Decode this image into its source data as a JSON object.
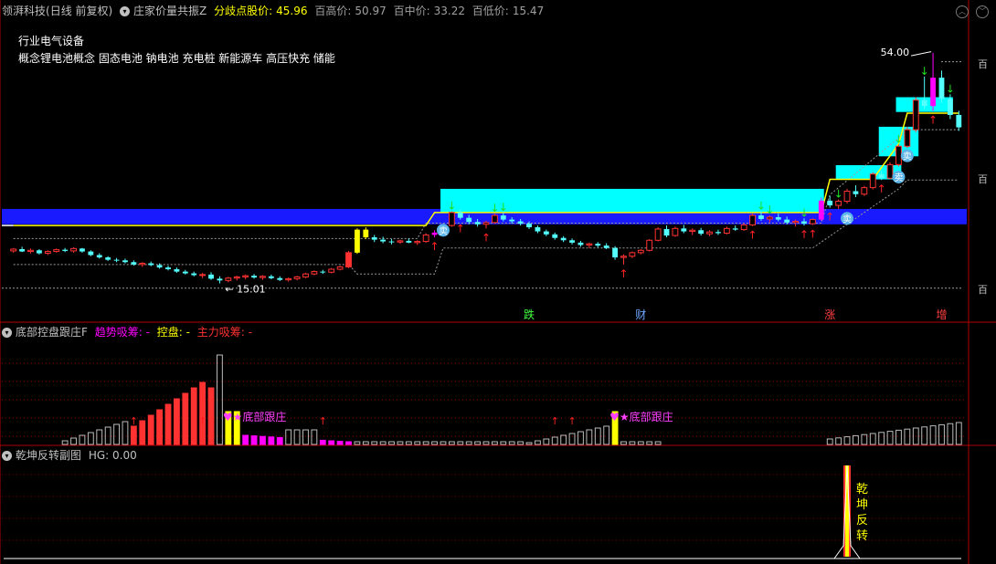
{
  "colors": {
    "up": "#ff3232",
    "down": "#54ffff",
    "yellow": "#ffff00",
    "magenta": "#ff00ff",
    "cyan_box": "#00ffff",
    "blue_band": "#1a1aff",
    "grid": "#8b0000",
    "text": "#c0c0c0"
  },
  "main_panel": {
    "stock_name": "领湃科技",
    "period": "(日线 前复权)",
    "indicator_icon": "circle-chevron-icon",
    "indicator_name": "庄家价量共振Z",
    "pivot_label": "分歧点股价:",
    "pivot_value": "45.96",
    "high_label": "百高价:",
    "high_value": "50.97",
    "mid_label": "百中价:",
    "mid_value": "33.22",
    "low_label": "百低价:",
    "low_value": "15.47",
    "industry_text": "行业电气设备",
    "concept_text": "概念锂电池概念 固态电池 钠电池 充电桩 新能源车 高压快充 储能",
    "max_label": "54.00",
    "min_label": "15.01",
    "right_labels": [
      "百",
      "百",
      "百"
    ],
    "event_markers": [
      "跌",
      "财",
      "涨",
      "增"
    ],
    "sell_marker": "卖",
    "up_arrow": "↑",
    "down_arrow": "↓"
  },
  "sub_panel_1": {
    "indicator_icon": "circle-chevron-icon",
    "name": "底部控盘跟庄F",
    "trend_label": "趋势吸筹: -",
    "control_label": "控盘: -",
    "main_label": "主力吸筹: -",
    "annotation": "底部跟庄"
  },
  "sub_panel_2": {
    "indicator_icon": "circle-chevron-icon",
    "name": "乾坤反转副图",
    "hg_label": "HG: 0.00",
    "annotation_chars": [
      "乾",
      "坤",
      "反",
      "转"
    ]
  },
  "chart_data": {
    "type": "candlestick",
    "ylim": [
      12,
      58
    ],
    "candles": [
      [
        20.5,
        21.0,
        20.2,
        20.8
      ],
      [
        20.8,
        21.2,
        20.3,
        20.4
      ],
      [
        20.4,
        20.9,
        20.1,
        20.6
      ],
      [
        20.6,
        20.8,
        19.9,
        20.1
      ],
      [
        20.1,
        20.6,
        19.8,
        20.4
      ],
      [
        20.4,
        20.9,
        20.2,
        20.7
      ],
      [
        20.7,
        21.0,
        20.3,
        20.5
      ],
      [
        20.5,
        21.1,
        20.2,
        20.9
      ],
      [
        20.9,
        21.0,
        20.2,
        20.4
      ],
      [
        20.4,
        20.6,
        19.6,
        19.8
      ],
      [
        19.8,
        20.1,
        19.2,
        19.4
      ],
      [
        19.4,
        19.6,
        18.8,
        19.0
      ],
      [
        19.0,
        19.3,
        18.6,
        18.9
      ],
      [
        18.9,
        19.2,
        18.4,
        18.6
      ],
      [
        18.6,
        18.9,
        18.0,
        18.2
      ],
      [
        18.2,
        18.6,
        17.8,
        18.4
      ],
      [
        18.4,
        18.7,
        17.9,
        18.1
      ],
      [
        18.1,
        18.4,
        17.5,
        17.7
      ],
      [
        17.7,
        18.0,
        17.2,
        17.4
      ],
      [
        17.4,
        17.7,
        16.8,
        17.0
      ],
      [
        17.0,
        17.3,
        16.5,
        16.7
      ],
      [
        16.7,
        17.0,
        16.2,
        16.4
      ],
      [
        16.4,
        16.8,
        15.9,
        16.5
      ],
      [
        16.5,
        16.9,
        15.6,
        15.8
      ],
      [
        15.8,
        16.2,
        15.0,
        15.5
      ],
      [
        15.5,
        16.1,
        15.2,
        15.9
      ],
      [
        15.9,
        16.3,
        15.5,
        16.1
      ],
      [
        16.1,
        16.5,
        15.7,
        16.3
      ],
      [
        16.3,
        16.6,
        15.8,
        16.0
      ],
      [
        16.0,
        16.4,
        15.6,
        16.2
      ],
      [
        16.2,
        16.5,
        15.7,
        15.9
      ],
      [
        15.9,
        16.2,
        15.4,
        15.6
      ],
      [
        15.6,
        16.0,
        15.3,
        15.8
      ],
      [
        15.8,
        16.3,
        15.5,
        16.1
      ],
      [
        16.1,
        16.8,
        15.9,
        16.6
      ],
      [
        16.6,
        17.2,
        16.4,
        17.0
      ],
      [
        17.0,
        17.3,
        16.6,
        16.9
      ],
      [
        16.9,
        17.6,
        16.7,
        17.4
      ],
      [
        17.4,
        18.0,
        17.2,
        17.8
      ],
      [
        17.8,
        20.5,
        17.6,
        20.2
      ],
      [
        20.2,
        24.3,
        20.0,
        24.1
      ],
      [
        24.1,
        24.5,
        22.5,
        22.8
      ],
      [
        22.8,
        23.2,
        22.0,
        22.4
      ],
      [
        22.4,
        22.9,
        21.8,
        22.1
      ],
      [
        22.1,
        22.5,
        21.6,
        22.0
      ],
      [
        22.0,
        22.4,
        21.7,
        22.2
      ],
      [
        22.2,
        22.6,
        21.8,
        21.9
      ],
      [
        21.9,
        22.3,
        21.5,
        22.1
      ],
      [
        22.1,
        23.5,
        21.9,
        23.2
      ],
      [
        23.2,
        24.0,
        22.8,
        23.6
      ],
      [
        23.6,
        25.0,
        23.4,
        24.8
      ],
      [
        24.8,
        27.2,
        24.6,
        27.0
      ],
      [
        27.0,
        27.5,
        25.8,
        26.1
      ],
      [
        26.1,
        26.6,
        25.0,
        25.4
      ],
      [
        25.4,
        25.9,
        24.6,
        25.0
      ],
      [
        25.0,
        25.6,
        24.3,
        25.3
      ],
      [
        25.3,
        26.8,
        25.1,
        26.5
      ],
      [
        26.5,
        27.0,
        25.5,
        25.8
      ],
      [
        25.8,
        26.2,
        25.1,
        25.5
      ],
      [
        25.5,
        25.9,
        24.8,
        25.1
      ],
      [
        25.1,
        25.5,
        24.2,
        24.5
      ],
      [
        24.5,
        24.8,
        23.5,
        23.8
      ],
      [
        23.8,
        24.1,
        23.0,
        23.3
      ],
      [
        23.3,
        23.6,
        22.4,
        22.7
      ],
      [
        22.7,
        23.0,
        22.0,
        22.3
      ],
      [
        22.3,
        22.6,
        21.6,
        21.9
      ],
      [
        21.9,
        22.2,
        21.2,
        21.5
      ],
      [
        21.5,
        21.9,
        21.0,
        21.7
      ],
      [
        21.7,
        22.0,
        21.1,
        21.4
      ],
      [
        21.4,
        21.8,
        20.8,
        21.0
      ],
      [
        21.0,
        21.3,
        19.0,
        19.4
      ],
      [
        19.4,
        19.9,
        18.2,
        19.6
      ],
      [
        19.6,
        20.4,
        19.3,
        20.2
      ],
      [
        20.2,
        20.8,
        19.9,
        20.6
      ],
      [
        20.6,
        22.5,
        20.4,
        22.3
      ],
      [
        22.3,
        24.5,
        22.1,
        24.2
      ],
      [
        24.2,
        24.8,
        22.8,
        23.1
      ],
      [
        23.1,
        24.6,
        22.9,
        24.3
      ],
      [
        24.3,
        24.9,
        23.5,
        23.8
      ],
      [
        23.8,
        24.3,
        23.2,
        24.0
      ],
      [
        24.0,
        24.4,
        23.1,
        23.4
      ],
      [
        23.4,
        24.0,
        23.0,
        23.7
      ],
      [
        23.7,
        24.1,
        23.2,
        23.5
      ],
      [
        23.5,
        24.6,
        23.3,
        24.3
      ],
      [
        24.3,
        24.8,
        23.9,
        24.1
      ],
      [
        24.1,
        25.2,
        23.9,
        24.9
      ],
      [
        24.9,
        26.8,
        24.7,
        26.5
      ],
      [
        26.5,
        27.2,
        25.6,
        25.9
      ],
      [
        25.9,
        26.5,
        25.3,
        26.2
      ],
      [
        26.2,
        26.8,
        25.5,
        25.8
      ],
      [
        25.8,
        26.3,
        25.0,
        25.3
      ],
      [
        25.3,
        25.8,
        24.6,
        25.5
      ],
      [
        25.5,
        26.0,
        24.8,
        25.1
      ],
      [
        25.1,
        26.0,
        24.9,
        25.8
      ],
      [
        25.8,
        29.5,
        25.6,
        29.0
      ],
      [
        29.0,
        29.8,
        27.8,
        28.2
      ],
      [
        28.2,
        29.2,
        27.6,
        28.9
      ],
      [
        28.9,
        31.0,
        28.5,
        30.6
      ],
      [
        30.6,
        31.6,
        29.6,
        30.1
      ],
      [
        30.1,
        31.5,
        29.8,
        31.2
      ],
      [
        31.2,
        33.8,
        30.9,
        33.5
      ],
      [
        33.5,
        34.0,
        32.5,
        32.8
      ],
      [
        32.8,
        35.5,
        32.6,
        35.1
      ],
      [
        35.1,
        38.5,
        34.8,
        38.2
      ],
      [
        38.2,
        41.5,
        37.9,
        41.0
      ],
      [
        41.0,
        46.5,
        40.6,
        46.0
      ],
      [
        46.0,
        50.0,
        44.5,
        45.0
      ],
      [
        45.0,
        54.0,
        44.2,
        49.8
      ],
      [
        49.8,
        51.0,
        45.5,
        46.2
      ],
      [
        46.2,
        47.0,
        42.8,
        43.5
      ],
      [
        43.5,
        44.2,
        40.8,
        41.4
      ]
    ]
  }
}
